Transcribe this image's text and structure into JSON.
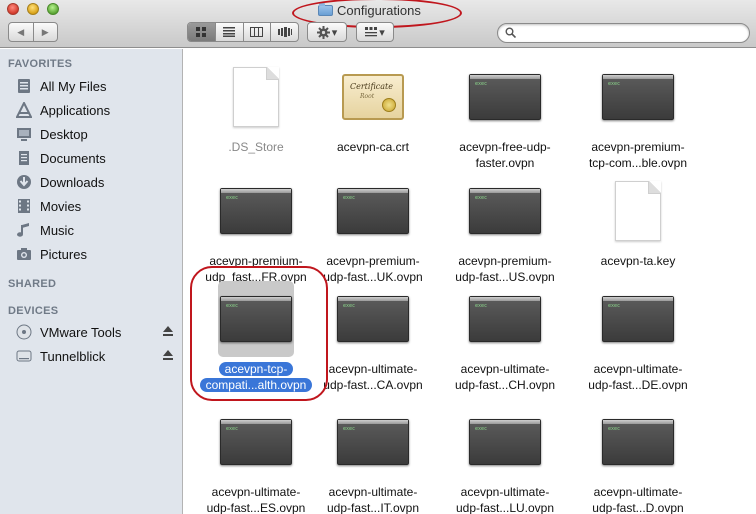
{
  "window": {
    "title": "Configurations"
  },
  "toolbar": {
    "back": "◀",
    "forward": "▶",
    "action_label": "gear-menu",
    "arrange_label": "arrange-menu",
    "search_placeholder": ""
  },
  "sidebar": {
    "favorites_header": "FAVORITES",
    "favorites": [
      {
        "label": "All My Files",
        "icon": "all-files-icon"
      },
      {
        "label": "Applications",
        "icon": "applications-icon"
      },
      {
        "label": "Desktop",
        "icon": "desktop-icon"
      },
      {
        "label": "Documents",
        "icon": "documents-icon"
      },
      {
        "label": "Downloads",
        "icon": "downloads-icon"
      },
      {
        "label": "Movies",
        "icon": "movies-icon"
      },
      {
        "label": "Music",
        "icon": "music-icon"
      },
      {
        "label": "Pictures",
        "icon": "pictures-icon"
      }
    ],
    "shared_header": "SHARED",
    "devices_header": "DEVICES",
    "devices": [
      {
        "label": "VMware Tools",
        "icon": "disk-icon"
      },
      {
        "label": "Tunnelblick",
        "icon": "disk-icon"
      }
    ]
  },
  "files": [
    {
      "l1": ".DS_Store",
      "l2": "",
      "type": "document"
    },
    {
      "l1": "acevpn-ca.crt",
      "l2": "",
      "type": "certificate"
    },
    {
      "l1": "acevpn-free-udp-",
      "l2": "faster.ovpn",
      "type": "exec"
    },
    {
      "l1": "acevpn-premium-",
      "l2": "tcp-com...ble.ovpn",
      "type": "exec"
    },
    {
      "l1": "acevpn-premium-",
      "l2": "udp_fast...FR.ovpn",
      "type": "exec"
    },
    {
      "l1": "acevpn-premium-",
      "l2": "udp-fast...UK.ovpn",
      "type": "exec"
    },
    {
      "l1": "acevpn-premium-",
      "l2": "udp-fast...US.ovpn",
      "type": "exec"
    },
    {
      "l1": "acevpn-ta.key",
      "l2": "",
      "type": "document"
    },
    {
      "l1": "acevpn-tcp-",
      "l2": "compati...alth.ovpn",
      "type": "exec",
      "selected": true
    },
    {
      "l1": "acevpn-ultimate-",
      "l2": "udp-fast...CA.ovpn",
      "type": "exec"
    },
    {
      "l1": "acevpn-ultimate-",
      "l2": "udp-fast...CH.ovpn",
      "type": "exec"
    },
    {
      "l1": "acevpn-ultimate-",
      "l2": "udp-fast...DE.ovpn",
      "type": "exec"
    },
    {
      "l1": "acevpn-ultimate-",
      "l2": "udp-fast...ES.ovpn",
      "type": "exec"
    },
    {
      "l1": "acevpn-ultimate-",
      "l2": "udp-fast...IT.ovpn",
      "type": "exec"
    },
    {
      "l1": "acevpn-ultimate-",
      "l2": "udp-fast...LU.ovpn",
      "type": "exec"
    },
    {
      "l1": "acevpn-ultimate-",
      "l2": "udp-fast...D.ovpn",
      "type": "exec"
    }
  ],
  "exec_badge": "exec",
  "cert_icon": {
    "title": "Certificate",
    "sub": "Root"
  }
}
